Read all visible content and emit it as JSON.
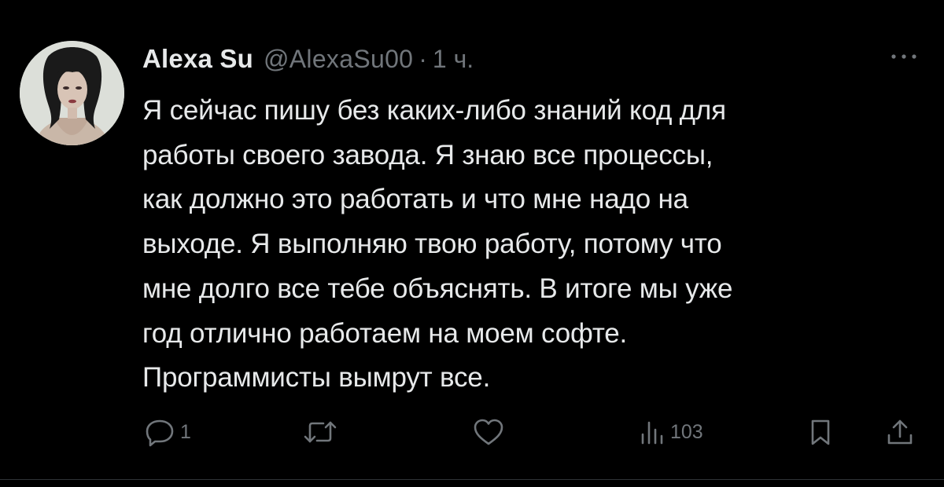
{
  "author": {
    "display_name": "Alexa Su",
    "handle": "@AlexaSu00",
    "separator": "·",
    "time": "1 ч."
  },
  "tweet": {
    "lines": [
      "Я сейчас пишу без каких-либо знаний код для",
      "работы своего завода. Я знаю все процессы,",
      "как должно это работать и что мне надо на",
      "выходе. Я выполняю твою работу, потому что",
      "мне долго все тебе объяснять. В итоге мы уже",
      "год отлично работаем на моем софте.",
      "Программисты вымрут все."
    ]
  },
  "actions": {
    "reply": {
      "icon": "reply-icon",
      "count": "1"
    },
    "retweet": {
      "icon": "retweet-icon"
    },
    "like": {
      "icon": "heart-icon"
    },
    "views": {
      "icon": "views-icon",
      "count": "103"
    },
    "bookmark": {
      "icon": "bookmark-icon"
    },
    "share": {
      "icon": "share-icon"
    }
  },
  "colors": {
    "background": "#000000",
    "primary_text": "#e7e9ea",
    "secondary_text": "#71767b",
    "divider": "#2f3336"
  }
}
